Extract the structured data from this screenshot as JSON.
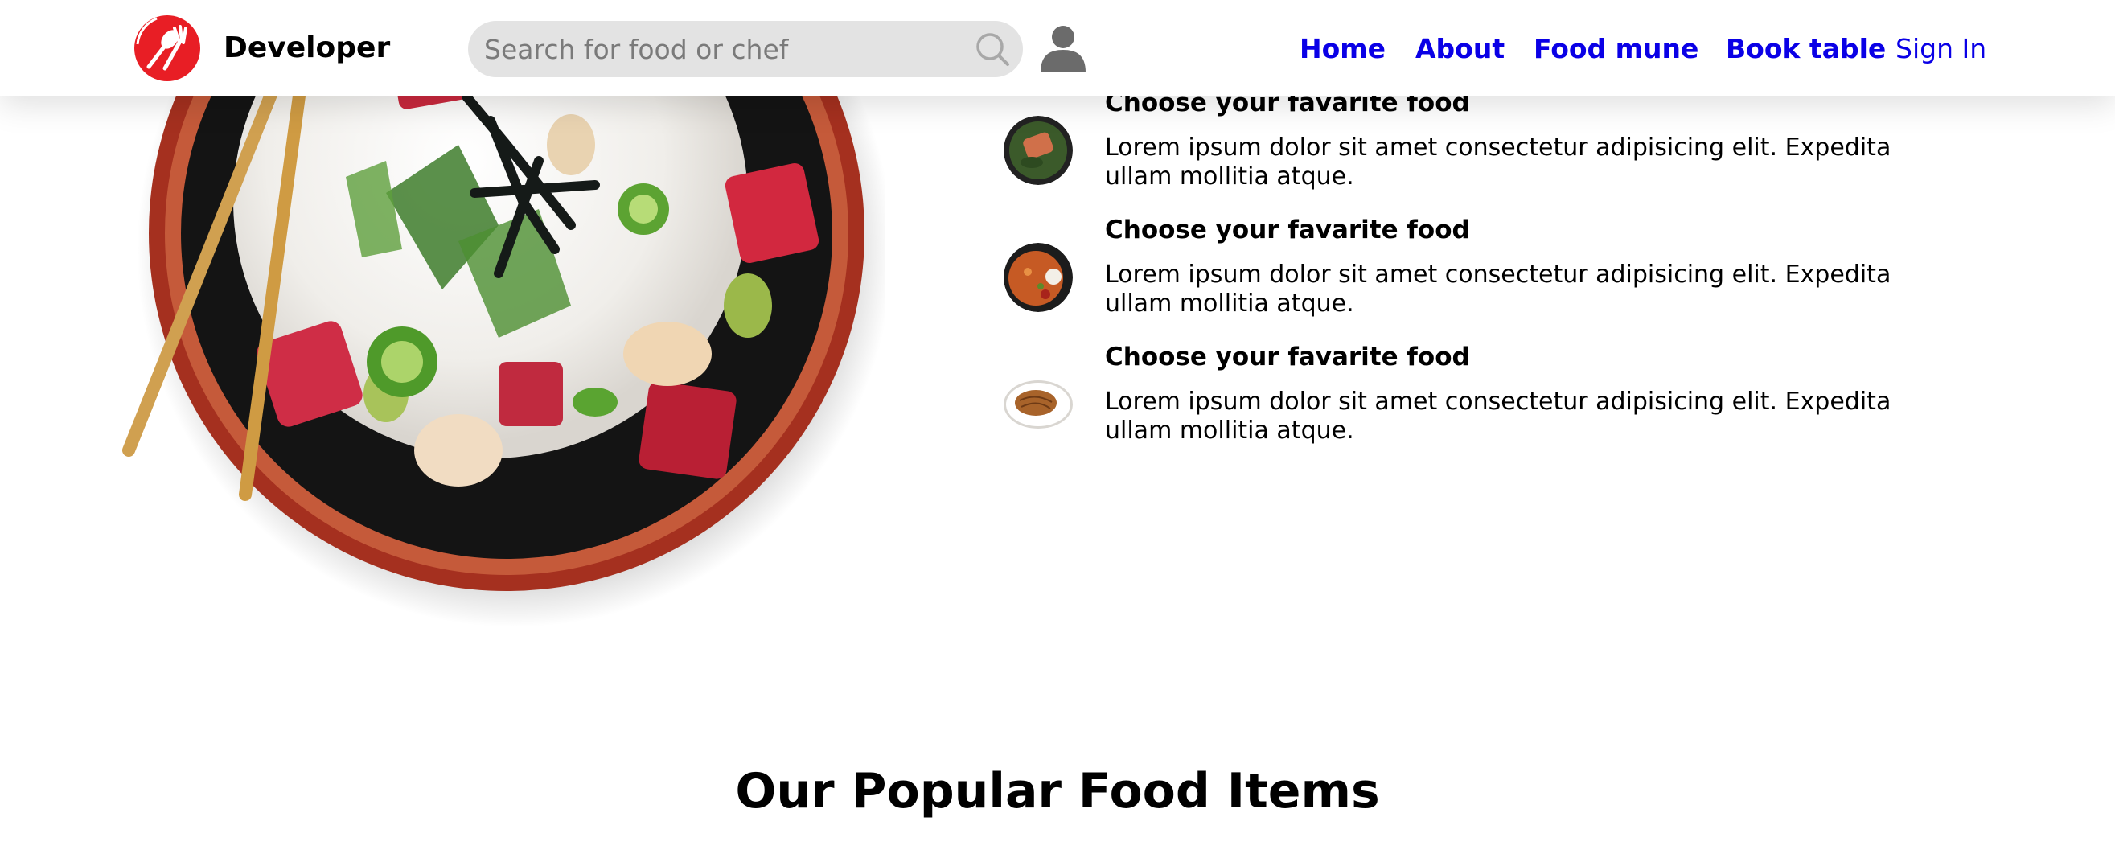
{
  "header": {
    "brand": "Developer",
    "logo_icon": "fork-spoon-logo-icon",
    "accent_color": "#e81e25",
    "search": {
      "placeholder": "Search for food or chef",
      "value": "",
      "icon": "search-icon"
    },
    "user_icon": "user-icon",
    "nav": [
      {
        "label": "Home"
      },
      {
        "label": "About"
      },
      {
        "label": "Food mune"
      },
      {
        "label": "Book table"
      },
      {
        "label": "Sign In"
      }
    ],
    "link_color": "#0a00e6"
  },
  "features": [
    {
      "title": "Choose your favarite food",
      "text": "Lorem ipsum dolor sit amet consectetur adipisicing elit. Expedita ullam mollitia atque."
    },
    {
      "title": "Choose your favarite food",
      "text": "Lorem ipsum dolor sit amet consectetur adipisicing elit. Expedita ullam mollitia atque."
    },
    {
      "title": "Choose your favarite food",
      "text": "Lorem ipsum dolor sit amet consectetur adipisicing elit. Expedita ullam mollitia atque."
    }
  ],
  "popular": {
    "title": "Our Popular Food Items"
  }
}
